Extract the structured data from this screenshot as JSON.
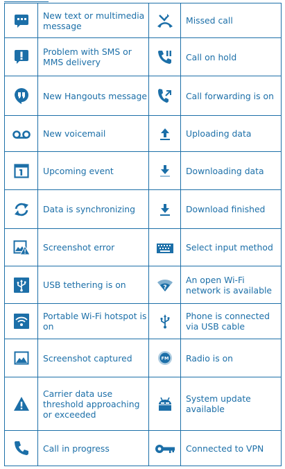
{
  "colors": {
    "accent": "#1c6fa8",
    "background": "#ffffff"
  },
  "rows": [
    {
      "left": {
        "icon": "message-icon",
        "text": "New text or multimedia message"
      },
      "right": {
        "icon": "missed-call-icon",
        "text": "Missed call"
      }
    },
    {
      "left": {
        "icon": "sms-problem-icon",
        "text": "Problem with SMS or MMS delivery"
      },
      "right": {
        "icon": "call-on-hold-icon",
        "text": "Call on hold"
      }
    },
    {
      "left": {
        "icon": "hangouts-icon",
        "text": "New Hangouts message"
      },
      "right": {
        "icon": "call-forwarding-icon",
        "text": "Call forwarding is on"
      }
    },
    {
      "left": {
        "icon": "voicemail-icon",
        "text": "New voicemail"
      },
      "right": {
        "icon": "upload-icon",
        "text": "Uploading data"
      }
    },
    {
      "left": {
        "icon": "calendar-icon",
        "text": "Upcoming event"
      },
      "right": {
        "icon": "download-icon",
        "text": "Downloading data"
      }
    },
    {
      "left": {
        "icon": "sync-icon",
        "text": "Data is synchronizing"
      },
      "right": {
        "icon": "download-finished-icon",
        "text": "Download finished"
      }
    },
    {
      "left": {
        "icon": "screenshot-error-icon",
        "text": "Screenshot error"
      },
      "right": {
        "icon": "keyboard-icon",
        "text": "Select input method"
      }
    },
    {
      "left": {
        "icon": "usb-tethering-icon",
        "text": "USB tethering is on"
      },
      "right": {
        "icon": "open-wifi-icon",
        "text": "An open Wi-Fi network is available"
      }
    },
    {
      "left": {
        "icon": "wifi-hotspot-icon",
        "text": "Portable Wi-Fi hotspot is on"
      },
      "right": {
        "icon": "usb-icon",
        "text": "Phone is connected via USB cable"
      }
    },
    {
      "left": {
        "icon": "screenshot-captured-icon",
        "text": "Screenshot captured"
      },
      "right": {
        "icon": "radio-icon",
        "text": "Radio is on"
      }
    },
    {
      "left": {
        "icon": "warning-icon",
        "text": "Carrier data use threshold approaching or exceeded"
      },
      "right": {
        "icon": "system-update-icon",
        "text": "System update available"
      }
    },
    {
      "left": {
        "icon": "call-icon",
        "text": "Call in progress"
      },
      "right": {
        "icon": "vpn-key-icon",
        "text": "Connected to VPN"
      }
    }
  ]
}
